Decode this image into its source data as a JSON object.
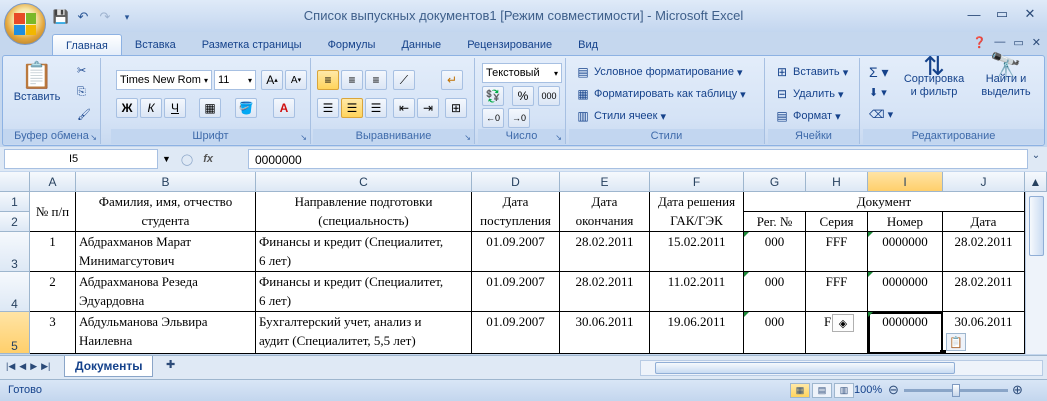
{
  "title_bar": {
    "title": "Список выпускных документов1  [Режим совместимости] - Microsoft Excel",
    "qat_icons": [
      "save-icon",
      "undo-icon",
      "redo-icon",
      "customize-icon"
    ],
    "controls": [
      "minimize-icon",
      "maximize-icon",
      "close-icon"
    ],
    "minimize": "—",
    "maximize": "▭",
    "close": "✕"
  },
  "tabs": [
    "Главная",
    "Вставка",
    "Разметка страницы",
    "Формулы",
    "Данные",
    "Рецензирование",
    "Вид"
  ],
  "active_tab": "Главная",
  "ribbon": {
    "clipboard": {
      "label": "Буфер обмена",
      "paste": "Вставить"
    },
    "font": {
      "label": "Шрифт",
      "font_name": "Times New Rom",
      "font_size": "11",
      "bold": "Ж",
      "italic": "К",
      "underline": "Ч"
    },
    "alignment": {
      "label": "Выравнивание"
    },
    "number": {
      "label": "Число",
      "format": "Текстовый",
      "percent": "%",
      "thousands": "000"
    },
    "styles": {
      "label": "Стили",
      "conditional": "Условное форматирование",
      "as_table": "Форматировать как таблицу",
      "cell_styles": "Стили ячеек"
    },
    "cells": {
      "label": "Ячейки",
      "insert": "Вставить",
      "delete": "Удалить",
      "format": "Формат"
    },
    "editing": {
      "label": "Редактирование",
      "sort": "Сортировка\nи фильтр",
      "find": "Найти и\nвыделить"
    }
  },
  "formula_bar": {
    "name_box": "I5",
    "fx": "fx",
    "value": "0000000"
  },
  "columns": [
    "A",
    "B",
    "C",
    "D",
    "E",
    "F",
    "G",
    "H",
    "I",
    "J"
  ],
  "selected_column": "I",
  "rows": [
    "1",
    "2",
    "3",
    "4",
    "5"
  ],
  "selected_row": "5",
  "header": {
    "num": "№ п/п",
    "fio": "Фамилия, имя, отчество\nстудента",
    "direction": "Направление подготовки\n(специальность)",
    "enroll": "Дата\nпоступления",
    "finish": "Дата\nокончания",
    "gak": "Дата решения\nГАК/ГЭК",
    "document": "Документ",
    "reg": "Рег. №",
    "series": "Серия",
    "number": "Номер",
    "date": "Дата"
  },
  "records": [
    {
      "num": "1",
      "fio": "Абдрахманов Марат\nМинимагсутович",
      "direction": "Финансы и кредит (Специалитет,\n6 лет)",
      "enroll": "01.09.2007",
      "finish": "28.02.2011",
      "gak": "15.02.2011",
      "reg": "000",
      "series": "FFF",
      "number": "0000000",
      "date": "28.02.2011"
    },
    {
      "num": "2",
      "fio": "Абдрахманова Резеда\nЭдуардовна",
      "direction": "Финансы и кредит (Специалитет,\n6 лет)",
      "enroll": "01.09.2007",
      "finish": "28.02.2011",
      "gak": "11.02.2011",
      "reg": "000",
      "series": "FFF",
      "number": "0000000",
      "date": "28.02.2011"
    },
    {
      "num": "3",
      "fio": "Абдульманова Эльвира\nНаилевна",
      "direction": "Бухгалтерский учет, анализ и\nаудит (Специалитет, 5,5 лет)",
      "enroll": "01.09.2007",
      "finish": "30.06.2011",
      "gak": "19.06.2011",
      "reg": "000",
      "series": "F",
      "number": "0000000",
      "date": "30.06.2011"
    }
  ],
  "sheet_tab": "Документы",
  "status": {
    "text": "Готово",
    "zoom": "100%"
  }
}
